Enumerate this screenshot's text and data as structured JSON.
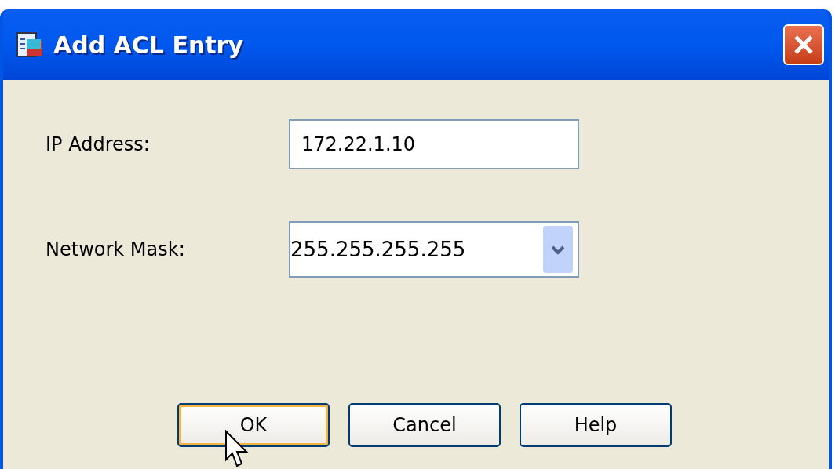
{
  "window": {
    "title": "Add ACL Entry"
  },
  "fields": [
    {
      "kind": "text",
      "label": "IP Address:",
      "value": "172.22.1.10"
    },
    {
      "kind": "combo",
      "label": "Network Mask:",
      "value": "255.255.255.255"
    }
  ],
  "buttons": [
    {
      "label": "OK",
      "focused": true
    },
    {
      "label": "Cancel",
      "focused": false
    },
    {
      "label": "Help",
      "focused": false
    }
  ]
}
